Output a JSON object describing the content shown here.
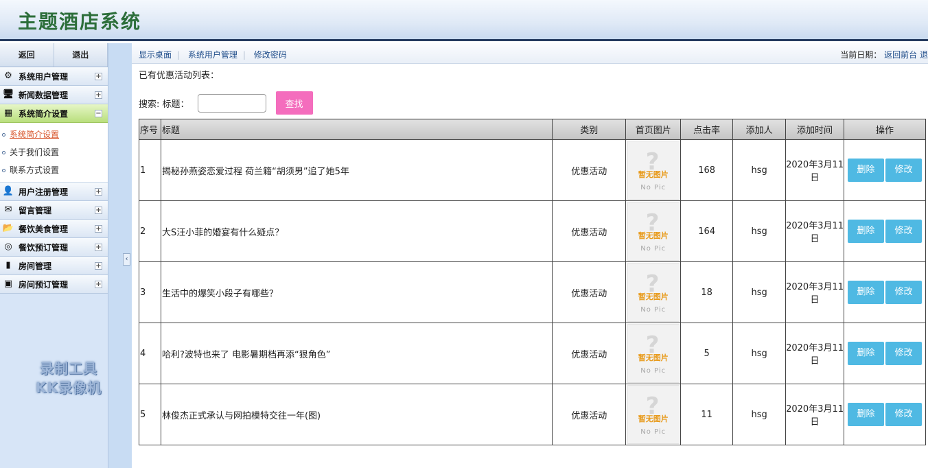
{
  "header": {
    "title": "主题酒店系统"
  },
  "sidebar": {
    "back_label": "返回",
    "logout_label": "退出",
    "menus": [
      {
        "label": "系统用户管理",
        "icon": "gear-icon",
        "toggle": "+"
      },
      {
        "label": "新闻数据管理",
        "icon": "monitor-icon",
        "toggle": "+"
      },
      {
        "label": "系统简介设置",
        "icon": "calendar-icon",
        "toggle": "−"
      },
      {
        "label": "用户注册管理",
        "icon": "user-icon",
        "toggle": "+"
      },
      {
        "label": "留言管理",
        "icon": "message-icon",
        "toggle": "+"
      },
      {
        "label": "餐饮美食管理",
        "icon": "folder-icon",
        "toggle": "+"
      },
      {
        "label": "餐饮预订管理",
        "icon": "coins-icon",
        "toggle": "+"
      },
      {
        "label": "房间管理",
        "icon": "bar-chart-icon",
        "toggle": "+"
      },
      {
        "label": "房间预订管理",
        "icon": "vip-icon",
        "toggle": "+"
      }
    ],
    "submenu": [
      {
        "label": "系统简介设置"
      },
      {
        "label": "关于我们设置"
      },
      {
        "label": "联系方式设置"
      }
    ],
    "watermark_line1": "录制工具",
    "watermark_line2": "KK录像机"
  },
  "toolbar": {
    "links": [
      "显示桌面",
      "系统用户管理",
      "修改密码"
    ],
    "date_label": "当前日期：",
    "back_front": "返回前台",
    "exit_partial": "退"
  },
  "main": {
    "list_title": "已有优惠活动列表：",
    "search_label": "搜索: 标题：",
    "search_value": "",
    "search_button": "查找"
  },
  "table": {
    "headers": [
      "序号",
      "标题",
      "类别",
      "首页图片",
      "点击率",
      "添加人",
      "添加时间",
      "操作"
    ],
    "no_pic_cn": "暂无图片",
    "no_pic_en": "No Pic",
    "delete_label": "删除",
    "edit_label": "修改",
    "rows": [
      {
        "id": "1",
        "title": "揭秘孙燕姿恋爱过程 荷兰籍“胡须男”追了她5年",
        "category": "优惠活动",
        "clicks": "168",
        "adder": "hsg",
        "time": "2020年3月11日"
      },
      {
        "id": "2",
        "title": "大S汪小菲的婚宴有什么疑点？",
        "category": "优惠活动",
        "clicks": "164",
        "adder": "hsg",
        "time": "2020年3月11日"
      },
      {
        "id": "3",
        "title": "生活中的爆笑小段子有哪些？",
        "category": "优惠活动",
        "clicks": "18",
        "adder": "hsg",
        "time": "2020年3月11日"
      },
      {
        "id": "4",
        "title": "哈利?波特也来了 电影暑期档再添“狠角色”",
        "category": "优惠活动",
        "clicks": "5",
        "adder": "hsg",
        "time": "2020年3月11日"
      },
      {
        "id": "5",
        "title": "林俊杰正式承认与网拍模特交往一年(图)",
        "category": "优惠活动",
        "clicks": "11",
        "adder": "hsg",
        "time": "2020年3月11日"
      }
    ]
  }
}
